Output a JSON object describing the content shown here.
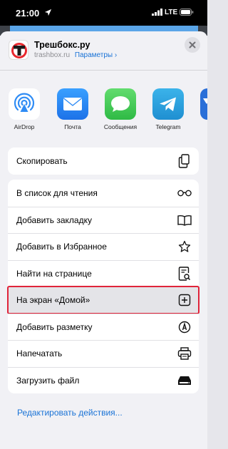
{
  "status": {
    "time": "21:00",
    "network": "LTE"
  },
  "site": {
    "title": "Трешбокс.ру",
    "domain": "trashbox.ru",
    "options_label": "Параметры",
    "options_chevron": "›"
  },
  "apps": [
    {
      "label": "AirDrop",
      "icon": "airdrop-icon",
      "color": "#ffffff"
    },
    {
      "label": "Почта",
      "icon": "mail-icon",
      "color": "#2f8cf5"
    },
    {
      "label": "Сообщения",
      "icon": "messages-icon",
      "color": "#36c24c"
    },
    {
      "label": "Telegram",
      "icon": "telegram-icon",
      "color": "#2ea6df"
    }
  ],
  "actions": {
    "copy": "Скопировать",
    "reading_list": "В список для чтения",
    "add_bookmark": "Добавить закладку",
    "add_favorites": "Добавить в Избранное",
    "find_on_page": "Найти на странице",
    "add_home": "На экран «Домой»",
    "markup": "Добавить разметку",
    "print": "Напечатать",
    "download": "Загрузить файл"
  },
  "edit_actions": "Редактировать действия...",
  "colors": {
    "accent": "#1a73d6",
    "highlight_border": "#e0243a"
  }
}
